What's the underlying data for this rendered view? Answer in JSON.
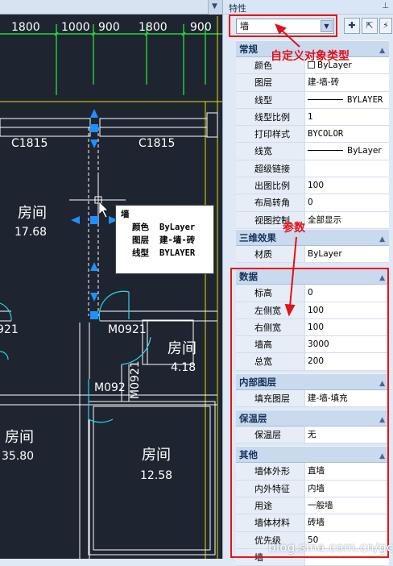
{
  "cad": {
    "dims_top": [
      "1800",
      "1000",
      "900",
      "1800",
      "900"
    ],
    "labels": [
      "C1815",
      "C1815",
      "M0921",
      "M0921",
      "M092",
      "M0921"
    ],
    "labels_partial": [
      "921"
    ],
    "rooms": [
      {
        "name": "房间",
        "area": "17.68"
      },
      {
        "name": "房间",
        "area": "4.18"
      },
      {
        "name": "房间",
        "area": "35.80"
      },
      {
        "name": "房间",
        "area": "12.58"
      }
    ],
    "tooltip": {
      "title": "墙",
      "rows": [
        {
          "k": "颜色",
          "v": "ByLayer"
        },
        {
          "k": "图层",
          "v": "建-墙-砖"
        },
        {
          "k": "线型",
          "v": "BYLAYER"
        }
      ]
    }
  },
  "panel": {
    "title": "特性",
    "type_select": "墙",
    "categories": {
      "general": "常规",
      "three_d": "三维效果",
      "data": "数据",
      "inner_layer": "内部图层",
      "insulation": "保温层",
      "other": "其他"
    },
    "general": [
      {
        "k": "颜色",
        "v": "ByLayer"
      },
      {
        "k": "图层",
        "v": "建-墙-砖"
      },
      {
        "k": "线型",
        "v": "BYLAYER"
      },
      {
        "k": "线型比例",
        "v": "1"
      },
      {
        "k": "打印样式",
        "v": "BYCOLOR"
      },
      {
        "k": "线宽",
        "v": "ByLayer"
      },
      {
        "k": "超级链接",
        "v": ""
      },
      {
        "k": "出图比例",
        "v": "100"
      },
      {
        "k": "布局转角",
        "v": "0"
      },
      {
        "k": "视图控制",
        "v": "全部显示"
      }
    ],
    "three_d": [
      {
        "k": "材质",
        "v": "ByLayer"
      }
    ],
    "data": [
      {
        "k": "标高",
        "v": "0"
      },
      {
        "k": "左侧宽",
        "v": "100"
      },
      {
        "k": "右侧宽",
        "v": "100"
      },
      {
        "k": "墙高",
        "v": "3000"
      },
      {
        "k": "总宽",
        "v": "200"
      }
    ],
    "inner_layer": [
      {
        "k": "填充图层",
        "v": "建-墙-填充"
      }
    ],
    "insulation": [
      {
        "k": "保温层",
        "v": "无"
      }
    ],
    "other": [
      {
        "k": "墙体外形",
        "v": "直墙"
      },
      {
        "k": "内外特征",
        "v": "内墙"
      },
      {
        "k": "用途",
        "v": "一般墙"
      },
      {
        "k": "墙体材料",
        "v": "砖墙"
      },
      {
        "k": "优先级",
        "v": "50"
      },
      {
        "k": "墙",
        "v": ""
      }
    ]
  },
  "annotations": {
    "custom_type": "自定义对象类型",
    "params": "参数"
  },
  "watermark": "blog.sina.com.cn/gcad",
  "colors": {
    "cad_bg": "#1e2430",
    "annotation": "#e0121a",
    "panel_bg": "#dfe9f5",
    "category_bg": "#c9d9ee",
    "grip": "#1e90ff"
  }
}
